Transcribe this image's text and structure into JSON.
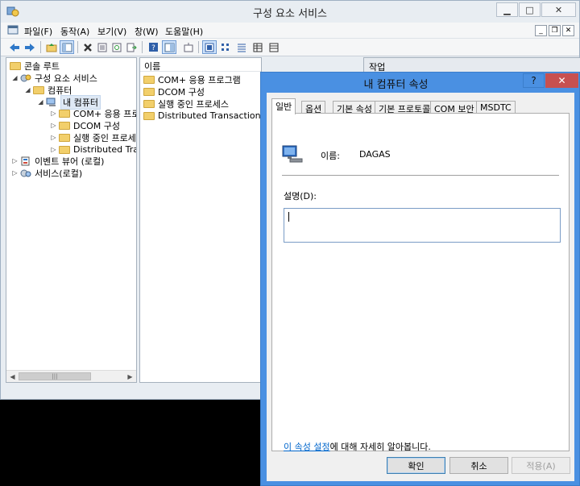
{
  "window": {
    "title": "구성 요소 서비스",
    "min": "▁",
    "max": "□",
    "close": "✕"
  },
  "menu": {
    "items": [
      "파일(F)",
      "동작(A)",
      "보기(V)",
      "창(W)",
      "도움말(H)"
    ],
    "mdi_min": "_",
    "mdi_restore": "❐",
    "mdi_close": "✕"
  },
  "toolbar": {
    "icons": [
      "back-icon",
      "forward-icon",
      "folder-up-icon",
      "console-tree-icon",
      "delete-icon",
      "properties-icon",
      "refresh-icon",
      "export-icon",
      "help-icon",
      "show-hide-icon",
      "new-window-icon",
      "large-icons-view-icon",
      "small-icons-view-icon",
      "list-view-icon",
      "detail-view-icon",
      "status-view-icon"
    ]
  },
  "tree": {
    "root": "콘솔 루트",
    "items": [
      {
        "label": "구성 요소 서비스",
        "expander": "◢"
      },
      {
        "label": "컴퓨터",
        "expander": "◢"
      },
      {
        "label": "내 컴퓨터",
        "expander": "◢"
      },
      {
        "label": "COM+ 응용 프로",
        "expander": "▷"
      },
      {
        "label": "DCOM 구성",
        "expander": "▷"
      },
      {
        "label": "실행 중인 프로세",
        "expander": "▷"
      },
      {
        "label": "Distributed Trans",
        "expander": "▷"
      },
      {
        "label": "이벤트 뷰어 (로컬)",
        "expander": "▷"
      },
      {
        "label": "서비스(로컬)",
        "expander": "▷"
      }
    ],
    "scroll_thumb": "|||"
  },
  "list": {
    "header": "이름",
    "items": [
      "COM+ 응용 프로그램",
      "DCOM 구성",
      "실행 중인 프로세스",
      "Distributed Transaction Coordinator"
    ]
  },
  "actions": {
    "header": "작업"
  },
  "dialog": {
    "title": "내 컴퓨터 속성",
    "help": "?",
    "close": "✕",
    "tabs": [
      "일반",
      "옵션",
      "기본 속성",
      "기본 프로토콜",
      "COM 보안",
      "MSDTC"
    ],
    "name_label": "이름:",
    "name_value": "DAGAS",
    "desc_label": "설명(D):",
    "desc_value": "",
    "link_text": "이 속성 설정",
    "link_suffix": "에 대해 자세히 알아봅니다.",
    "ok": "확인",
    "cancel": "취소",
    "apply": "적용(A)"
  },
  "colors": {
    "accent": "#4a90e2",
    "close_red": "#c75050",
    "link": "#0066cc",
    "folder": "#f2cf6b"
  }
}
